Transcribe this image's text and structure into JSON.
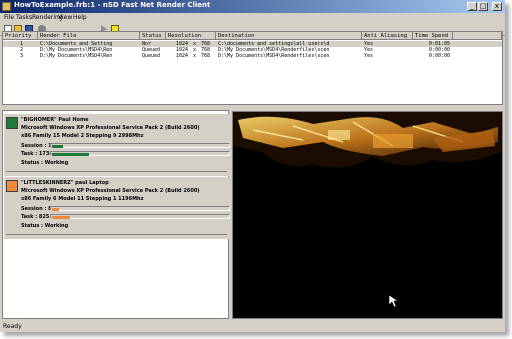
{
  "window": {
    "title": "HowToExample.frb:1 - nSD Fast Net Render Client",
    "controls": [
      "_",
      "□",
      "x"
    ]
  },
  "menu": [
    "File",
    "Tasks",
    "Rendering",
    "View",
    "Help"
  ],
  "toolbar": [
    "new-icon",
    "open-icon",
    "save-icon",
    "settings-icon",
    "play-icon",
    "stop-icon"
  ],
  "jobs": {
    "columns": [
      "Priority",
      "Render File",
      "Status",
      "Resolution",
      "Destination",
      "Anti Aliasing",
      "Time Spend"
    ],
    "rows": [
      {
        "priority": "1",
        "file": "C:\\Documents and Setting",
        "status": "Nor",
        "res_w": "1024",
        "res_x": "x",
        "res_h": "768",
        "dest": "C:\\documents and settings\\all users\\d",
        "aa": "Yes",
        "time": "0:01:05"
      },
      {
        "priority": "2",
        "file": "D:\\My Documents\\MSD4\\Ren",
        "status": "Queued",
        "res_w": "1024",
        "res_x": "x",
        "res_h": "768",
        "dest": "D:\\My Documents\\MSD4\\Renderfiles\\scen",
        "aa": "Yes",
        "time": "0:00:00"
      },
      {
        "priority": "3",
        "file": "D:\\My Documents\\MSD4\\Ren",
        "status": "Queued",
        "res_w": "1024",
        "res_x": "x",
        "res_h": "768",
        "dest": "D:\\My Documents\\MSD4\\Renderfiles\\scen",
        "aa": "Yes",
        "time": "0:00:00"
      }
    ]
  },
  "clients": [
    {
      "name": "\"BIGHOMER\" Paul Home",
      "os": "Microsoft Windows XP Professional Service Pack 2 (Build 2600)",
      "cpu": "x86 Family 15 Model 2 Stepping 9 2998Mhz",
      "session": "Session : 1738",
      "session_progress": 0.06,
      "task": "Task : 1738",
      "task_progress": 0.21,
      "status": "Status : Working",
      "color": "#1f7a3a"
    },
    {
      "name": "\"LITTLESKINNERZ\" paul Laptop",
      "os": "Microsoft Windows XP Professional Service Pack 2 (Build 2600)",
      "cpu": "x86 Family 6 Model 11 Stepping 1 1196Mhz",
      "session": "Session : 825",
      "session_progress": 0.04,
      "task": "Task : 825",
      "task_progress": 0.1,
      "status": "Status : Working",
      "color": "#f08a3c"
    }
  ],
  "statusbar": {
    "text": "Ready"
  }
}
